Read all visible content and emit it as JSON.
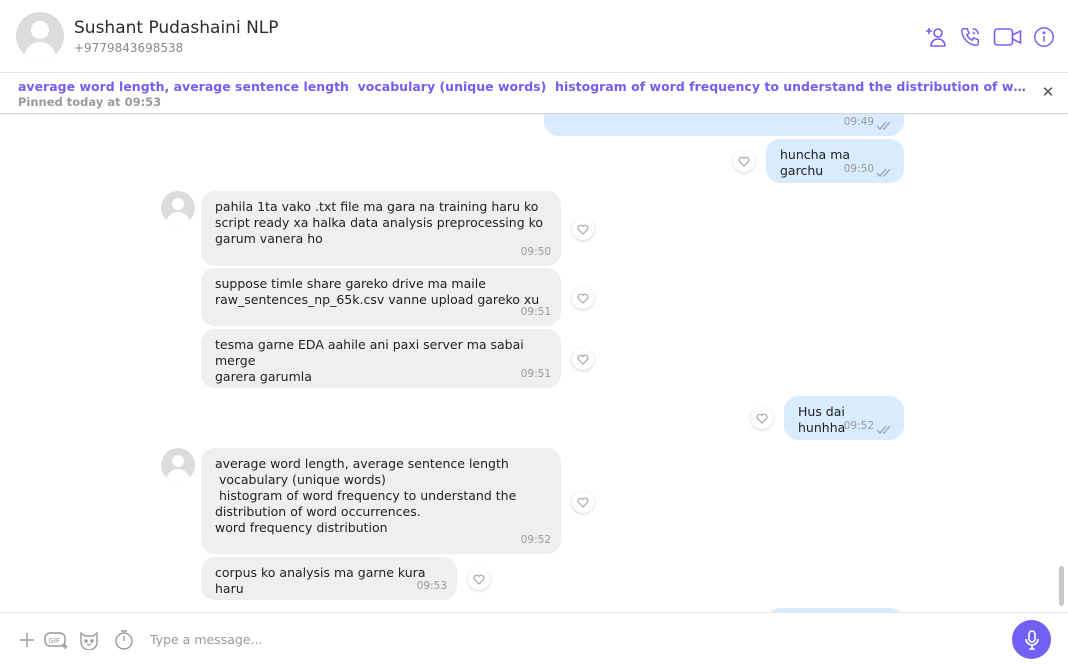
{
  "header": {
    "contact_name": "Sushant Pudashaini NLP",
    "contact_phone": "+9779843698538",
    "icons": [
      "add-contact-icon",
      "phone-icon",
      "video-icon",
      "info-icon"
    ]
  },
  "pinned": {
    "text": "average word length, average sentence length  vocabulary (unique words)  histogram of word frequency to understand the distribution of word occurrences. word frequency distribution",
    "time_label": "Pinned today at 09:53"
  },
  "messages": [
    {
      "direction": "out",
      "text": "",
      "time": "09:49"
    },
    {
      "direction": "out",
      "text": "huncha ma garchu",
      "time": "09:50"
    },
    {
      "direction": "in",
      "text": "pahila 1ta vako .txt file ma gara na training haru ko\nscript ready xa halka data analysis preprocessing ko\ngarum vanera ho",
      "time": "09:50"
    },
    {
      "direction": "in",
      "text": "suppose timle share gareko drive ma maile\nraw_sentences_np_65k.csv vanne upload gareko xu",
      "time": "09:51"
    },
    {
      "direction": "in",
      "text": "tesma garne EDA aahile ani paxi server ma sabai merge\ngarera garumla",
      "time": "09:51"
    },
    {
      "direction": "out",
      "text": "Hus dai hunhha",
      "time": "09:52"
    },
    {
      "direction": "in",
      "text": "average word length, average sentence length\n vocabulary (unique words)\n histogram of word frequency to understand the\ndistribution of word occurrences.\nword frequency distribution",
      "time": "09:52"
    },
    {
      "direction": "in",
      "text": "corpus ko analysis ma garne kura haru",
      "time": "09:53"
    }
  ],
  "composer": {
    "placeholder": "Type a message...",
    "icons": [
      "plus-icon",
      "gif-icon",
      "sticker-icon",
      "timer-icon",
      "microphone-icon"
    ]
  },
  "colors": {
    "accent": "#7360f2",
    "incoming_bubble": "#efefef",
    "outgoing_bubble": "#d9ebff"
  }
}
